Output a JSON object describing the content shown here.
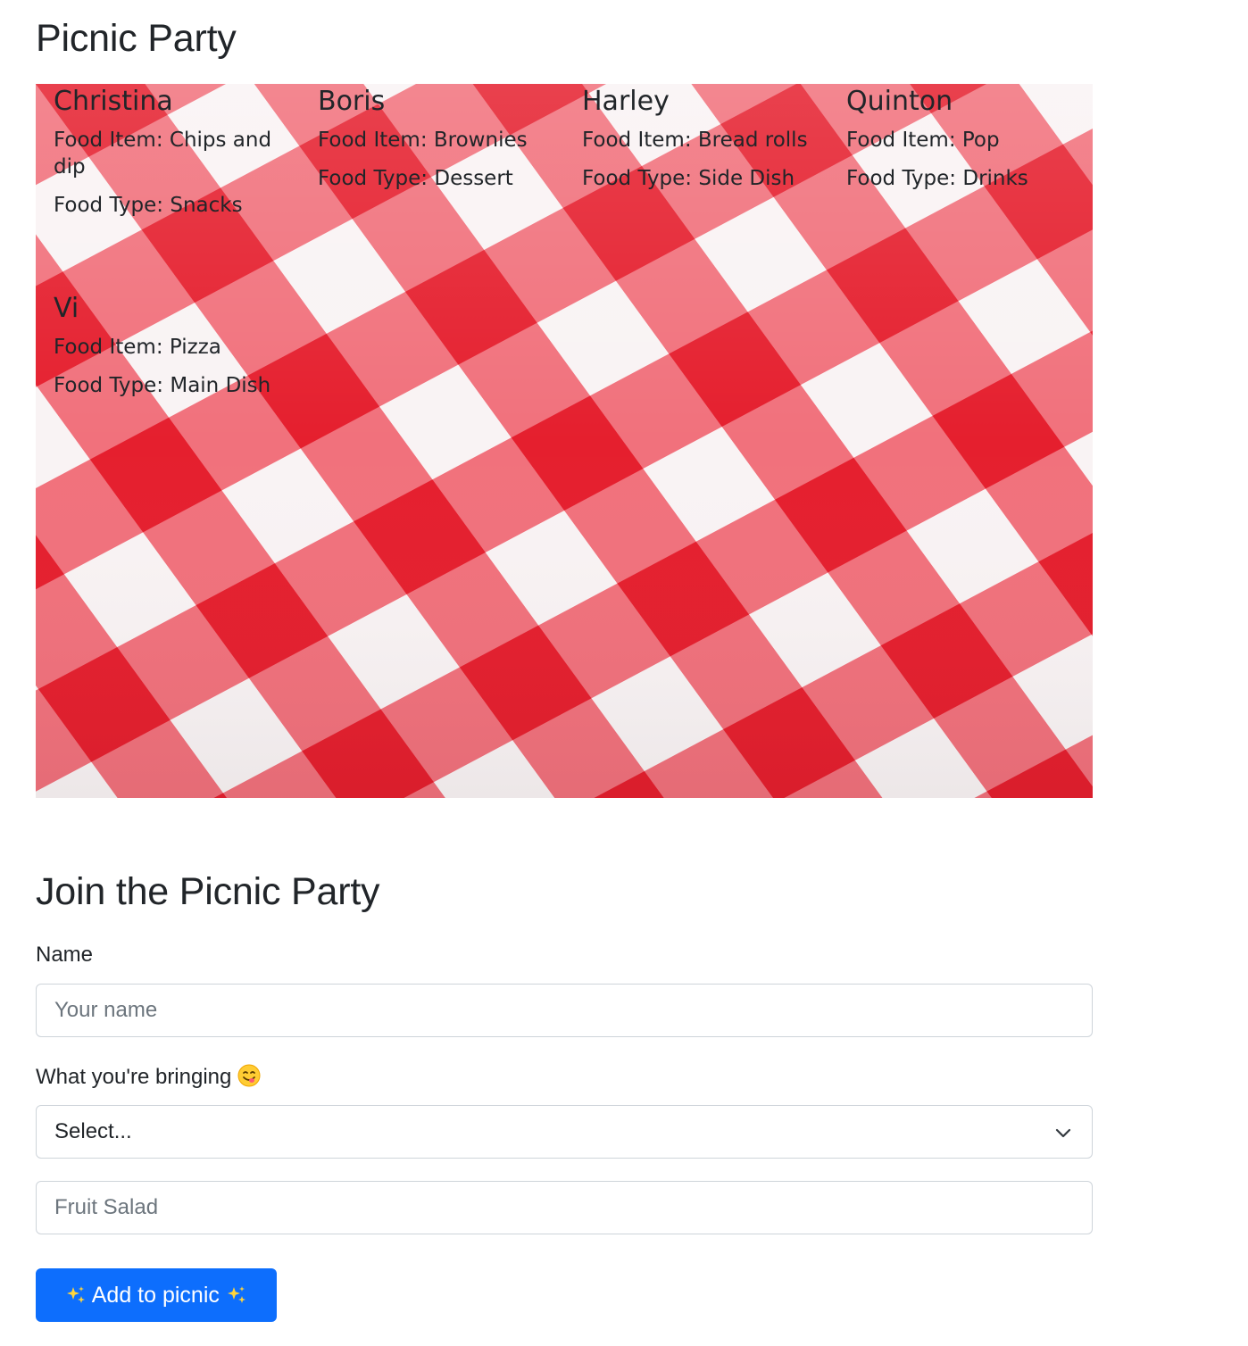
{
  "page": {
    "title": "Picnic Party"
  },
  "guests": [
    {
      "name": "Christina",
      "food_item": "Food Item: Chips and dip",
      "food_type": "Food Type: Snacks"
    },
    {
      "name": "Boris",
      "food_item": "Food Item: Brownies",
      "food_type": "Food Type: Dessert"
    },
    {
      "name": "Harley",
      "food_item": "Food Item: Bread rolls",
      "food_type": "Food Type: Side Dish"
    },
    {
      "name": "Quinton",
      "food_item": "Food Item: Pop",
      "food_type": "Food Type: Drinks"
    },
    {
      "name": "Vi",
      "food_item": "Food Item: Pizza",
      "food_type": "Food Type: Main Dish"
    }
  ],
  "form": {
    "title": "Join the Picnic Party",
    "name_label": "Name",
    "name_placeholder": "Your name",
    "bringing_label": "What you're bringing",
    "bringing_emoji": "yum-face-emoji",
    "select_value": "Select...",
    "food_placeholder": "Fruit Salad",
    "submit_label": "Add to picnic",
    "submit_decoration": "sparkles-icon"
  },
  "colors": {
    "primary": "#0d6efd",
    "gingham_red": "#e8212f",
    "text": "#212529",
    "placeholder": "#6c757d",
    "border": "#ced4da"
  }
}
